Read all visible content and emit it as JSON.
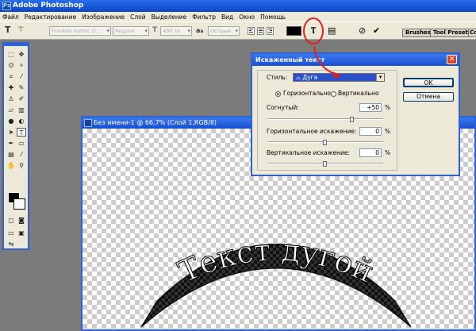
{
  "app": {
    "title": "Adobe Photoshop",
    "icon": "Ps"
  },
  "menu": [
    "Файл",
    "Редактирование",
    "Изображение",
    "Слой",
    "Выделение",
    "Фильтр",
    "Вид",
    "Окно",
    "Помощь"
  ],
  "options": {
    "tool_icon": "T",
    "font_family": "Franklin Gothic D...",
    "font_style": "Regular",
    "font_size": "400 пх",
    "aa_label": "a",
    "aa_method": "Острый",
    "text_color": "#000000",
    "panel_tabs": [
      "Brushes",
      "Tool Presets",
      "Co"
    ]
  },
  "document": {
    "title": "Без имени-1 @ 66,7% (Слой 1,RGB/8)",
    "warped_text": "Текст дугой"
  },
  "dialog": {
    "title": "Искаженный текст",
    "style_label": "Стиль:",
    "style_value": "Дуга",
    "orientation": {
      "horizontal": "Горизонтально",
      "vertical": "Вертикально",
      "selected": "horizontal"
    },
    "bend": {
      "label": "Согнутый:",
      "value": "+50",
      "unit": "%",
      "level": 0.75
    },
    "h_distortion": {
      "label": "Горизонтальное искажение:",
      "value": "0",
      "unit": "%",
      "level": 0.5
    },
    "v_distortion": {
      "label": "Вертикальное искажение:",
      "value": "0",
      "unit": "%",
      "level": 0.5
    },
    "ok": "OK",
    "cancel": "Отмена"
  },
  "colors": {
    "highlight": "#e02020",
    "titlebar": "#1a4fd0"
  }
}
